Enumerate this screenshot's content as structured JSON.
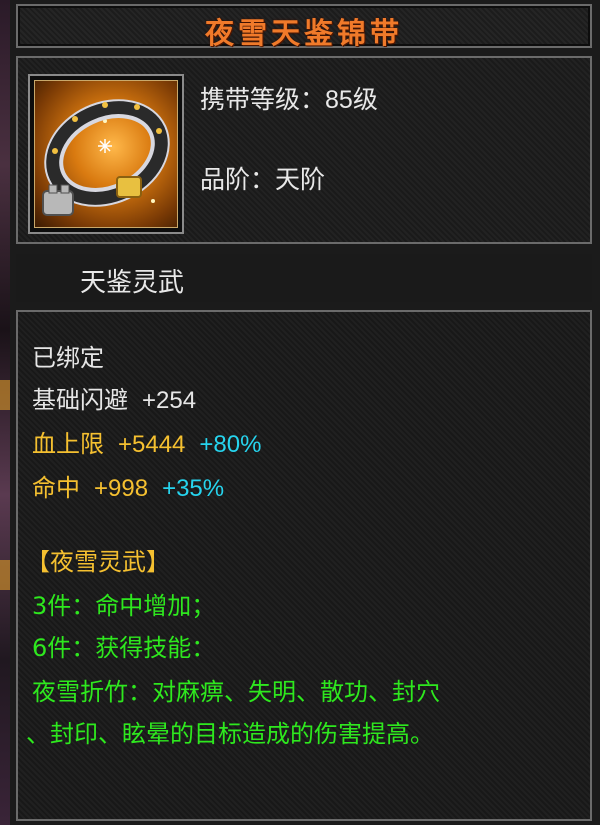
{
  "item": {
    "title": "夜雪天鉴锦带",
    "level_label": "携带等级：",
    "level_value": "85级",
    "grade_label": "品阶：",
    "grade_value": "天阶",
    "subtitle": "天鉴灵武"
  },
  "stats": {
    "bound": "已绑定",
    "dodge": {
      "label": "基础闪避",
      "value": "+254"
    },
    "hp": {
      "label": "血上限",
      "value": "+5444",
      "bonus": "+80%"
    },
    "hit": {
      "label": "命中",
      "value": "+998",
      "bonus": "+35%"
    }
  },
  "set": {
    "name": "【夜雪灵武】",
    "bonus3": "3件：命中增加；",
    "bonus6": "6件：获得技能：",
    "skill_line1": "夜雪折竹：对麻痹、失明、散功、封穴",
    "skill_line2": "、封印、眩晕的目标造成的伤害提高。"
  },
  "colors": {
    "title": "#f07a2a",
    "gold": "#f5c030",
    "cyan": "#26d4ee",
    "green": "#2ee81e",
    "white": "#e6e6e6"
  },
  "icons": {
    "item_icon": "belt-icon"
  }
}
